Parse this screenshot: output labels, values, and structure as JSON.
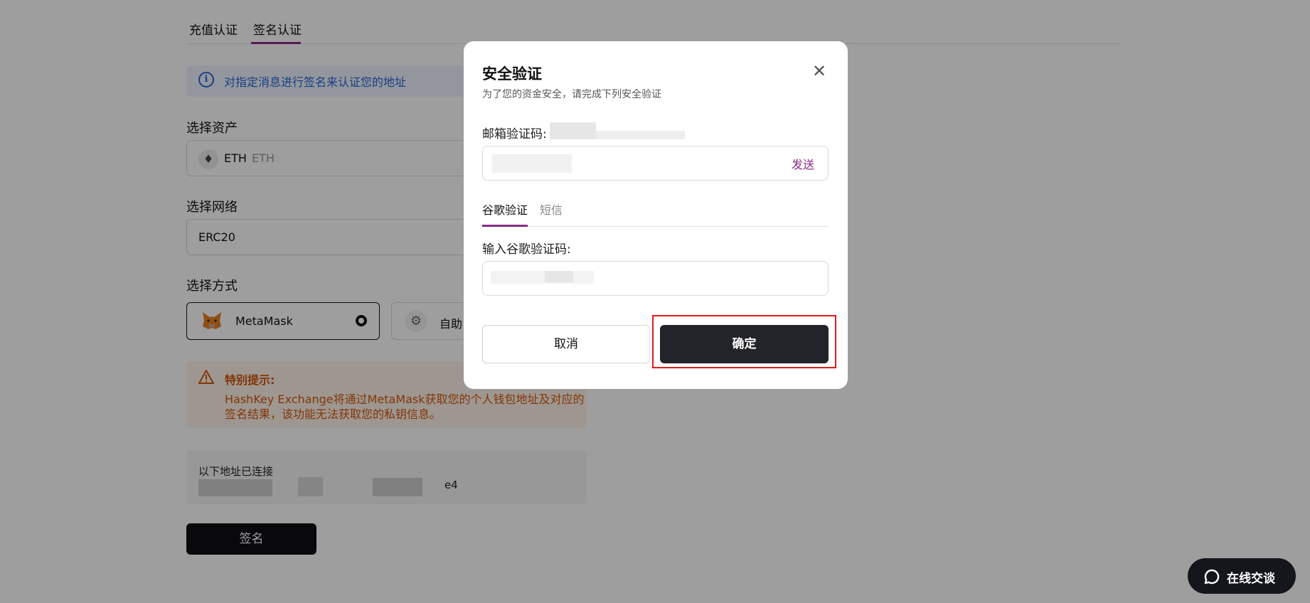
{
  "page_tabs": [
    {
      "label": "充值认证",
      "active": false
    },
    {
      "label": "签名认证",
      "active": true
    }
  ],
  "info_banner": {
    "text": "对指定消息进行签名来认证您的地址"
  },
  "select_asset": {
    "label": "选择资产",
    "symbol": "ETH",
    "name": "ETH"
  },
  "select_network": {
    "label": "选择网络",
    "value": "ERC20"
  },
  "select_method": {
    "label": "选择方式",
    "options": [
      {
        "label": "MetaMask",
        "selected": true
      },
      {
        "label": "自助",
        "selected": false
      }
    ]
  },
  "warning": {
    "title": "特别提示:",
    "line1": "HashKey Exchange将通过MetaMask获取您的个人钱包地址及对应的",
    "line2": "签名结果，该功能无法获取您的私钥信息。"
  },
  "connected": {
    "label": "以下地址已连接",
    "address_suffix": "e4"
  },
  "sign_button": "签名",
  "modal": {
    "title": "安全验证",
    "subtitle": "为了您的资金安全，请完成下列安全验证",
    "email_label": "邮箱验证码:",
    "send_label": "发送",
    "tabs": [
      {
        "label": "谷歌验证",
        "active": true
      },
      {
        "label": "短信",
        "active": false
      }
    ],
    "google_label": "输入谷歌验证码:",
    "cancel_label": "取消",
    "confirm_label": "确定"
  },
  "chat_button": "在线交谈",
  "colors": {
    "accent": "#8a2b86",
    "info_blue": "#2a63d6",
    "warning_orange": "#d4560b",
    "confirm_dark": "#23242a",
    "highlight_red": "#e51a1a"
  },
  "icons": [
    "info-icon",
    "eth-icon",
    "metamask-fox-icon",
    "gear-icon",
    "warning-icon",
    "close-icon",
    "chat-bubble-icon"
  ]
}
